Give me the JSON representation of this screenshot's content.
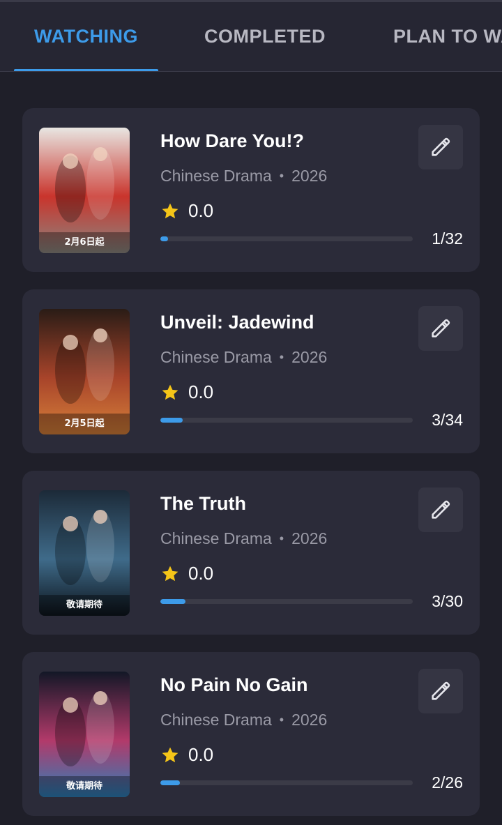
{
  "tabs": [
    {
      "label": "WATCHING",
      "active": true
    },
    {
      "label": "COMPLETED",
      "active": false
    },
    {
      "label": "PLAN TO WATCH",
      "active": false
    }
  ],
  "colors": {
    "accent": "#3d9be9",
    "star": "#f5c518",
    "background": "#1f1f29",
    "card": "#2b2b39"
  },
  "items": [
    {
      "title": "How Dare You!?",
      "type": "Chinese Drama",
      "year": "2026",
      "rating": "0.0",
      "episodes": "1/32",
      "progress": 0.03125,
      "poster_label": "2月6日起",
      "poster_colors": [
        "#e8e6e2",
        "#c9342c",
        "#8a8680"
      ]
    },
    {
      "title": "Unveil: Jadewind",
      "type": "Chinese Drama",
      "year": "2026",
      "rating": "0.0",
      "episodes": "3/34",
      "progress": 0.0882,
      "poster_label": "2月5日起",
      "poster_colors": [
        "#2a1c16",
        "#a8442a",
        "#d6803a"
      ]
    },
    {
      "title": "The Truth",
      "type": "Chinese Drama",
      "year": "2026",
      "rating": "0.0",
      "episodes": "3/30",
      "progress": 0.1,
      "poster_label": "敬请期待",
      "poster_colors": [
        "#1c2a38",
        "#3f6b8a",
        "#0d141c"
      ]
    },
    {
      "title": "No Pain No Gain",
      "type": "Chinese Drama",
      "year": "2026",
      "rating": "0.0",
      "episodes": "2/26",
      "progress": 0.0769,
      "poster_label": "敬请期待",
      "poster_colors": [
        "#121726",
        "#b23a6a",
        "#2d7fb8"
      ]
    }
  ]
}
